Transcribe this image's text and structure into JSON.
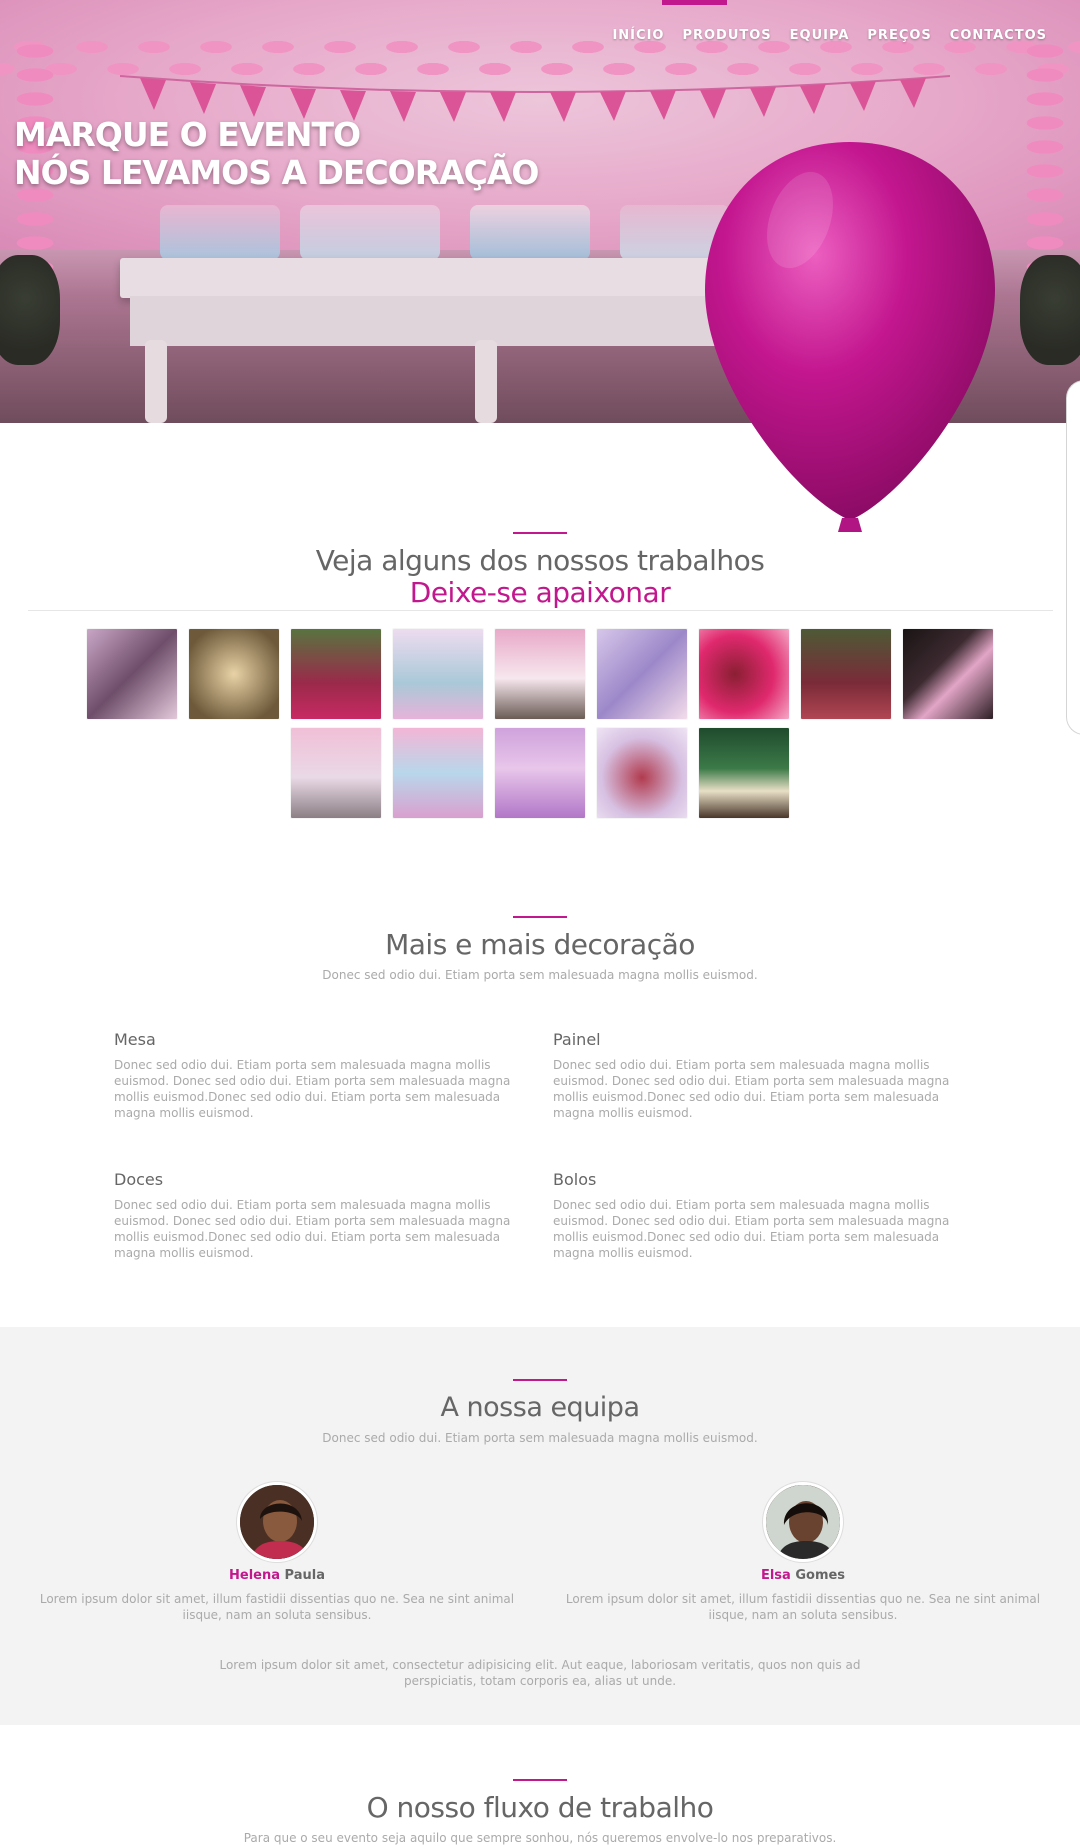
{
  "nav": {
    "items": [
      "INÍCIO",
      "PRODUTOS",
      "EQUIPA",
      "PREÇOS",
      "CONTACTOS"
    ],
    "active_index": 0,
    "accent": "#c2188e"
  },
  "hero": {
    "line1": "MARQUE O EVENTO",
    "line2": "NÓS LEVAMOS A DECORAÇÃO"
  },
  "works": {
    "title": "Veja alguns dos nossos trabalhos",
    "subtitle": "Deixe-se apaixonar",
    "gallery_count": 14
  },
  "more": {
    "title": "Mais e mais decoração",
    "subtitle": "Donec sed odio dui. Etiam porta sem malesuada magna mollis euismod.",
    "features": [
      {
        "title": "Mesa",
        "text": "Donec sed odio dui. Etiam porta sem malesuada magna mollis euismod. Donec sed odio dui. Etiam porta sem malesuada magna mollis euismod.Donec sed odio dui. Etiam porta sem malesuada magna mollis euismod."
      },
      {
        "title": "Painel",
        "text": "Donec sed odio dui. Etiam porta sem malesuada magna mollis euismod. Donec sed odio dui. Etiam porta sem malesuada magna mollis euismod.Donec sed odio dui. Etiam porta sem malesuada magna mollis euismod."
      },
      {
        "title": "Doces",
        "text": "Donec sed odio dui. Etiam porta sem malesuada magna mollis euismod. Donec sed odio dui. Etiam porta sem malesuada magna mollis euismod.Donec sed odio dui. Etiam porta sem malesuada magna mollis euismod."
      },
      {
        "title": "Bolos",
        "text": "Donec sed odio dui. Etiam porta sem malesuada magna mollis euismod. Donec sed odio dui. Etiam porta sem malesuada magna mollis euismod.Donec sed odio dui. Etiam porta sem malesuada magna mollis euismod."
      }
    ]
  },
  "team": {
    "title": "A nossa equipa",
    "subtitle": "Donec sed odio dui. Etiam porta sem malesuada magna mollis euismod.",
    "members": [
      {
        "first": "Helena",
        "last": "Paula",
        "bio": "Lorem ipsum dolor sit amet, illum fastidii dissentias quo ne. Sea ne sint animal iisque, nam an soluta sensibus."
      },
      {
        "first": "Elsa",
        "last": "Gomes",
        "bio": "Lorem ipsum dolor sit amet, illum fastidii dissentias quo ne. Sea ne sint animal iisque, nam an soluta sensibus."
      }
    ],
    "note": "Lorem ipsum dolor sit amet, consectetur adipisicing elit. Aut eaque, laboriosam veritatis, quos non quis ad perspiciatis, totam corporis ea, alias ut unde."
  },
  "flow": {
    "title": "O nosso fluxo de trabalho",
    "subtitle": "Para que o seu evento seja aquilo que sempre sonhou, nós queremos envolve-lo nos preparativos."
  }
}
